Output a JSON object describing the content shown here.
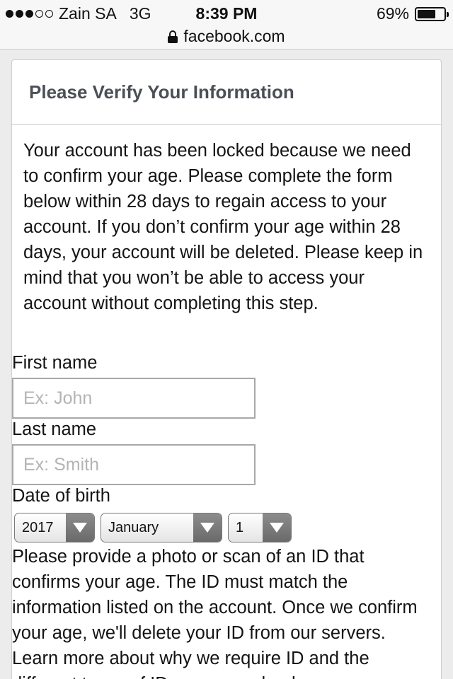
{
  "status_bar": {
    "carrier": "Zain SA",
    "network": "3G",
    "time": "8:39 PM",
    "battery_percent_text": "69%",
    "battery_level": 0.69,
    "signal_bars_filled": 3,
    "signal_bars_total": 5
  },
  "url_bar": {
    "domain": "facebook.com"
  },
  "card": {
    "title": "Please Verify Your Information",
    "intro": "Your account has been locked because we need to confirm your age. Please complete the form below within 28 days to regain access to your account. If you don’t confirm your age within 28 days, your account will be deleted. Please keep in mind that you won’t be able to access your account without completing this step."
  },
  "form": {
    "first_name_label": "First name",
    "first_name_placeholder": "Ex: John",
    "first_name_value": "",
    "last_name_label": "Last name",
    "last_name_placeholder": "Ex: Smith",
    "last_name_value": "",
    "dob_label": "Date of birth",
    "dob_year": "2017",
    "dob_month": "January",
    "dob_day": "1"
  },
  "id_section": {
    "text": "Please provide a photo or scan of an ID that confirms your age. The ID must match the information listed on the account. Once we confirm your age, we'll delete your ID from our servers. Learn more about why we require ID and the different types of ID you can upload."
  }
}
